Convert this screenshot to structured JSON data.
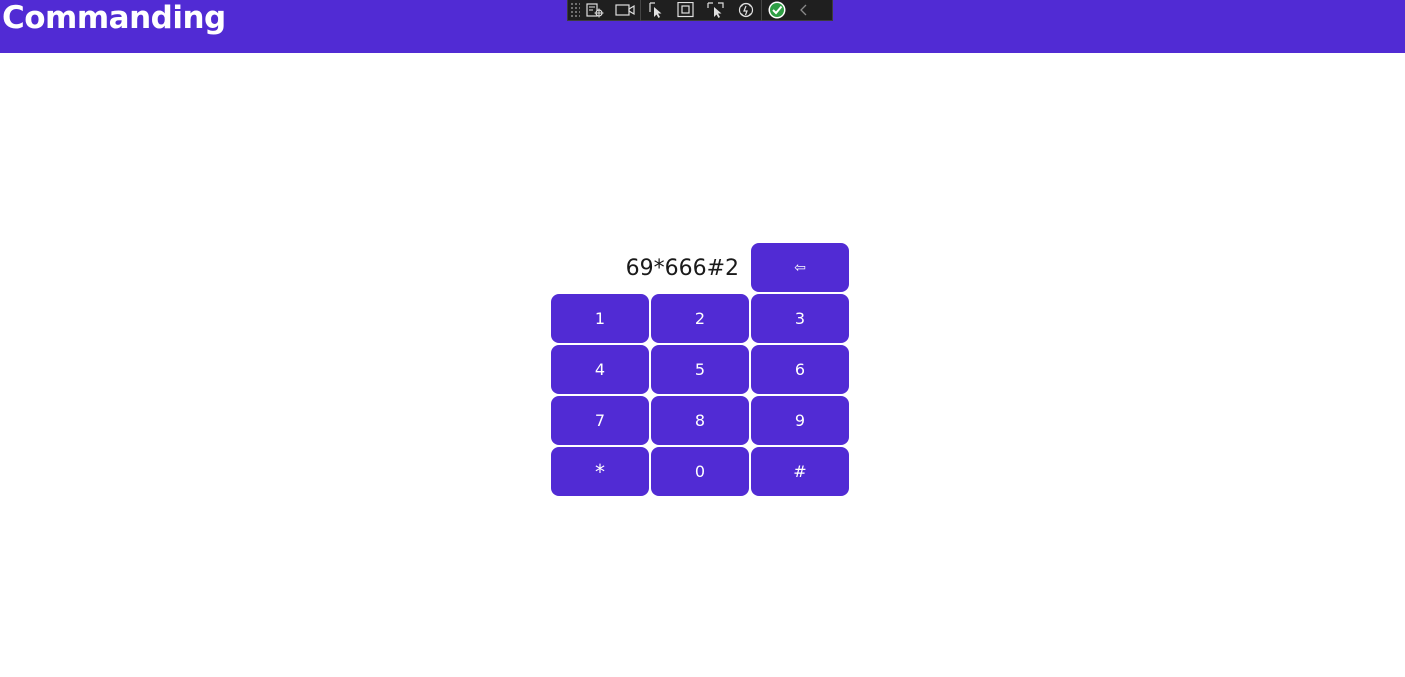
{
  "header": {
    "title": "Commanding",
    "background": "#512bd4"
  },
  "debug_toolbar": {
    "items": [
      {
        "icon": "live-visual-tree-icon"
      },
      {
        "icon": "video-camera-icon"
      },
      {
        "icon": "select-element-icon"
      },
      {
        "icon": "display-layout-adorners-icon"
      },
      {
        "icon": "track-focused-element-icon"
      },
      {
        "icon": "hot-reload-icon"
      },
      {
        "icon": "binding-failures-check-icon"
      },
      {
        "icon": "collapse-chevron-icon"
      }
    ]
  },
  "keypad": {
    "display_text": "69*666#2",
    "backspace_label": "⇦",
    "keys": [
      {
        "label": "1"
      },
      {
        "label": "2"
      },
      {
        "label": "3"
      },
      {
        "label": "4"
      },
      {
        "label": "5"
      },
      {
        "label": "6"
      },
      {
        "label": "7"
      },
      {
        "label": "8"
      },
      {
        "label": "9"
      },
      {
        "label": "*"
      },
      {
        "label": "0"
      },
      {
        "label": "#"
      }
    ],
    "button_color": "#512bd4",
    "text_color": "#ffffff"
  }
}
